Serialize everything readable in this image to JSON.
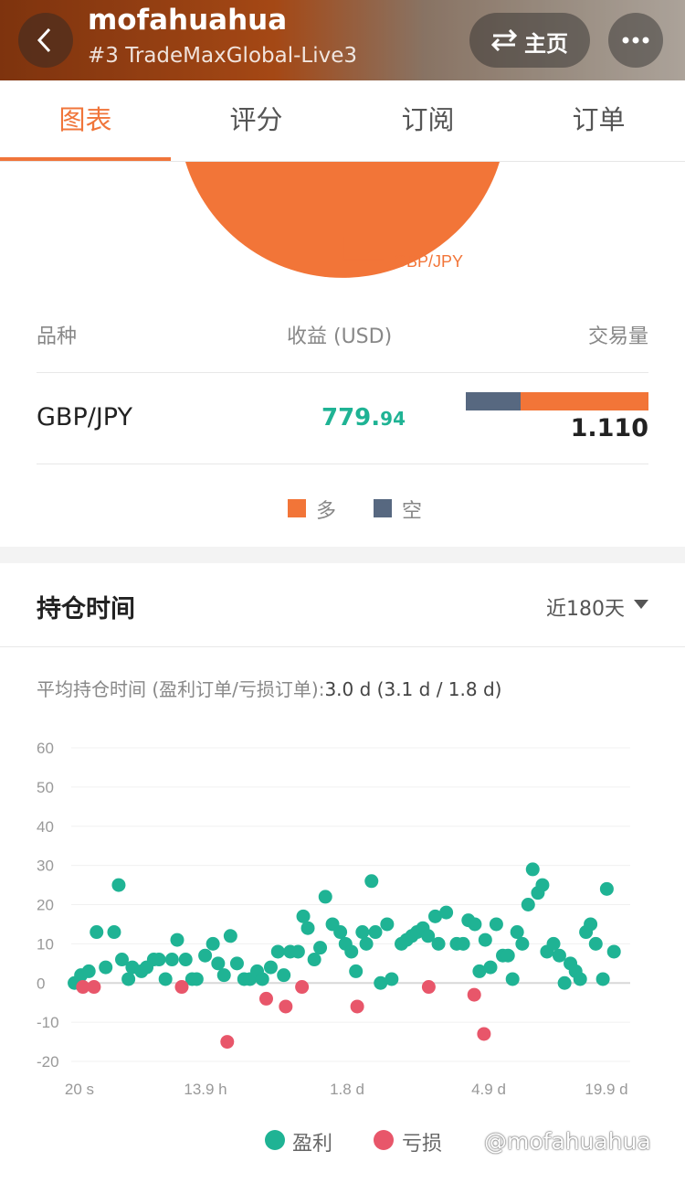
{
  "header": {
    "title": "mofahuahua",
    "subtitle": "#3 TradeMaxGlobal-Live3",
    "home_label": "主页"
  },
  "tabs": [
    {
      "label": "图表",
      "active": true
    },
    {
      "label": "评分",
      "active": false
    },
    {
      "label": "订阅",
      "active": false
    },
    {
      "label": "订单",
      "active": false
    }
  ],
  "pie": {
    "label": "GBP/JPY",
    "color": "#f27538"
  },
  "symbols_table": {
    "headers": {
      "symbol": "品种",
      "profit": "收益 (USD)",
      "volume": "交易量"
    },
    "rows": [
      {
        "symbol": "GBP/JPY",
        "profit_int": "779.",
        "profit_dec": "94",
        "volume": "1.110",
        "short_share": 0.3,
        "long_share": 0.7
      }
    ],
    "legend": {
      "long": "多",
      "short": "空",
      "long_color": "#f27538",
      "short_color": "#576880"
    }
  },
  "holding": {
    "title": "持仓时间",
    "period": "近180天",
    "avg_label": "平均持仓时间 (盈利订单/亏损订单):",
    "avg_value": "3.0 d (3.1 d / 1.8 d)"
  },
  "chart_data": {
    "type": "scatter",
    "ylim": [
      -20,
      60
    ],
    "yticks": [
      "60",
      "50",
      "40",
      "30",
      "20",
      "10",
      "0",
      "-10",
      "-20"
    ],
    "xticks": [
      "20 s",
      "13.9 h",
      "1.8 d",
      "4.9 d",
      "19.9 d"
    ],
    "series": [
      {
        "name": "盈利",
        "color": "#1fb394",
        "points": [
          [
            0.5,
            0
          ],
          [
            1.5,
            2
          ],
          [
            2.7,
            3
          ],
          [
            3.9,
            13
          ],
          [
            5.3,
            4
          ],
          [
            6.6,
            13
          ],
          [
            7.3,
            25
          ],
          [
            7.8,
            6
          ],
          [
            8.8,
            1
          ],
          [
            9.4,
            4
          ],
          [
            10.8,
            3
          ],
          [
            11.6,
            4
          ],
          [
            12.7,
            6
          ],
          [
            13.5,
            6
          ],
          [
            14.5,
            1
          ],
          [
            15.5,
            6
          ],
          [
            16.3,
            11
          ],
          [
            17.6,
            6
          ],
          [
            18.6,
            1
          ],
          [
            19.3,
            1
          ],
          [
            20.6,
            7
          ],
          [
            21.8,
            10
          ],
          [
            22.6,
            5
          ],
          [
            23.5,
            2
          ],
          [
            24.5,
            12
          ],
          [
            25.5,
            5
          ],
          [
            26.6,
            1
          ],
          [
            27.5,
            1
          ],
          [
            28.6,
            3
          ],
          [
            29.4,
            1
          ],
          [
            30.7,
            4
          ],
          [
            31.8,
            8
          ],
          [
            32.7,
            2
          ],
          [
            33.7,
            8
          ],
          [
            34.9,
            8
          ],
          [
            35.7,
            17
          ],
          [
            36.4,
            14
          ],
          [
            37.4,
            6
          ],
          [
            38.3,
            9
          ],
          [
            39.1,
            22
          ],
          [
            40.2,
            15
          ],
          [
            41.4,
            13
          ],
          [
            42.2,
            10
          ],
          [
            43.1,
            8
          ],
          [
            43.8,
            3
          ],
          [
            44.8,
            13
          ],
          [
            45.4,
            10
          ],
          [
            46.2,
            26
          ],
          [
            46.8,
            13
          ],
          [
            47.6,
            0
          ],
          [
            48.6,
            15
          ],
          [
            49.3,
            1
          ],
          [
            50.8,
            10
          ],
          [
            51.6,
            11
          ],
          [
            52.4,
            12
          ],
          [
            53.2,
            13
          ],
          [
            54.1,
            14
          ],
          [
            54.9,
            12
          ],
          [
            56,
            17
          ],
          [
            56.5,
            10
          ],
          [
            57.7,
            18
          ],
          [
            59.3,
            10
          ],
          [
            60.3,
            10
          ],
          [
            61.1,
            16
          ],
          [
            62.1,
            15
          ],
          [
            62.8,
            3
          ],
          [
            63.7,
            11
          ],
          [
            64.5,
            4
          ],
          [
            65.4,
            15
          ],
          [
            66.4,
            7
          ],
          [
            67.2,
            7
          ],
          [
            67.9,
            1
          ],
          [
            68.6,
            13
          ],
          [
            69.4,
            10
          ],
          [
            70.3,
            20
          ],
          [
            71,
            29
          ],
          [
            71.8,
            23
          ],
          [
            72.5,
            25
          ],
          [
            73.2,
            8
          ],
          [
            74.2,
            10
          ],
          [
            75.1,
            7
          ],
          [
            75.9,
            0
          ],
          [
            76.8,
            5
          ],
          [
            77.6,
            3
          ],
          [
            78.3,
            1
          ],
          [
            79.2,
            13
          ],
          [
            79.9,
            15
          ],
          [
            80.7,
            10
          ],
          [
            81.8,
            1
          ],
          [
            82.4,
            24
          ],
          [
            83.5,
            8
          ]
        ]
      },
      {
        "name": "亏损",
        "color": "#e8566a",
        "points": [
          [
            1.8,
            -1
          ],
          [
            3.5,
            -1
          ],
          [
            17,
            -1
          ],
          [
            24,
            -15
          ],
          [
            30,
            -4
          ],
          [
            33,
            -6
          ],
          [
            35.5,
            -1
          ],
          [
            44,
            -6
          ],
          [
            55,
            -1
          ],
          [
            62,
            -3
          ],
          [
            63.5,
            -13
          ]
        ]
      }
    ]
  },
  "watermark": "@mofahuahua"
}
